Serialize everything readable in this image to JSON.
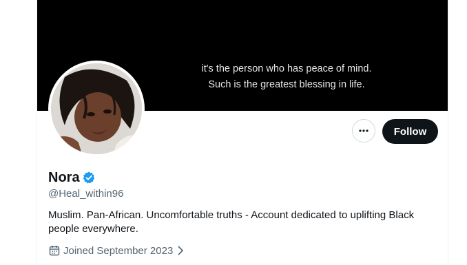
{
  "banner": {
    "line1": "it's the person who has peace of mind.",
    "line2": "Such is the greatest blessing in life."
  },
  "profile": {
    "display_name": "Nora",
    "handle": "@Heal_within96",
    "bio": "Muslim. Pan-African. Uncomfortable truths - Account dedicated to uplifting Black people everywhere.",
    "joined": "Joined September 2023"
  },
  "actions": {
    "follow_label": "Follow",
    "more_icon": "more-horizontal-icon"
  },
  "colors": {
    "verified": "#1d9bf0",
    "primary_text": "#0f1419",
    "secondary_text": "#536471",
    "button_dark": "#0f1419"
  },
  "icons": {
    "verified": "verified-badge-icon",
    "calendar": "calendar-icon",
    "chevron": "chevron-right-icon"
  }
}
